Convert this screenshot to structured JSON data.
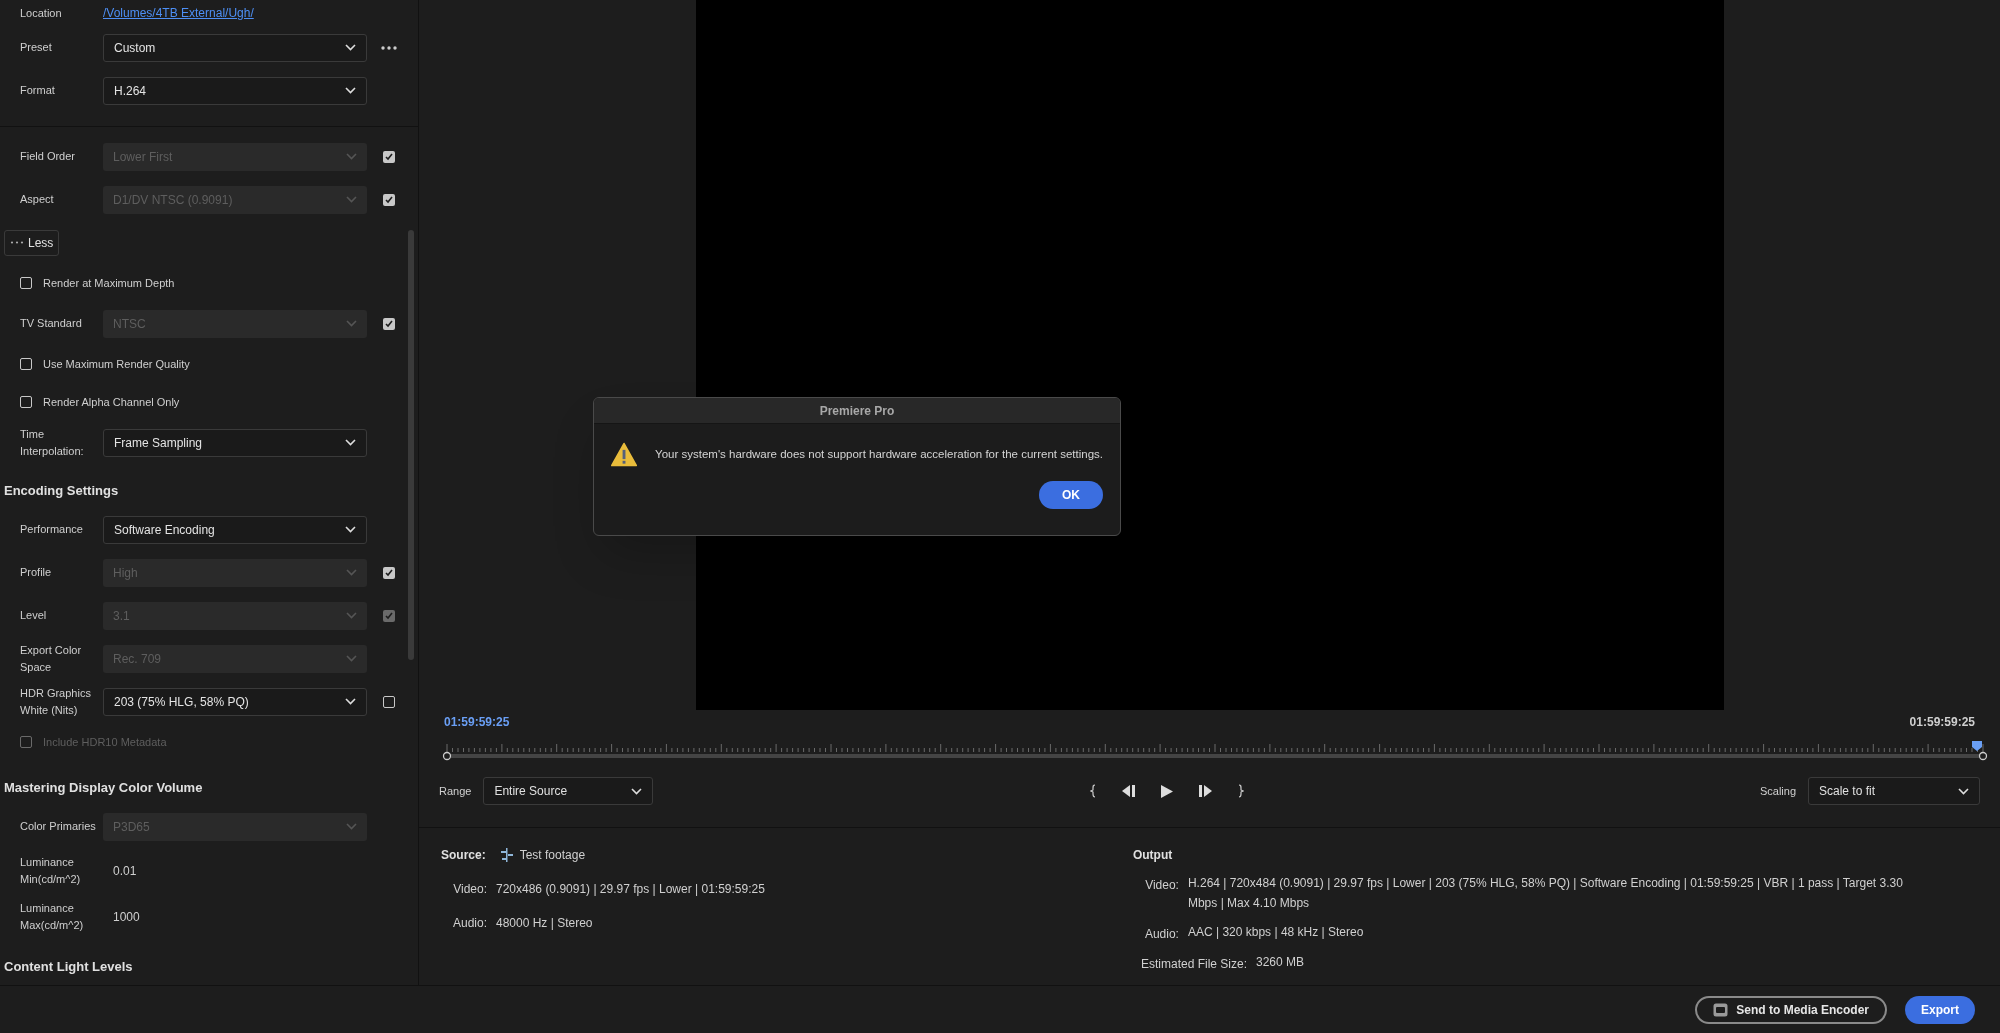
{
  "settings": [
    {
      "kind": "link",
      "label": "Location",
      "value": "/Volumes/4TB External/Ugh/"
    },
    {
      "kind": "dropdown",
      "label": "Preset",
      "value": "Custom",
      "disabled": false,
      "more": true
    },
    {
      "kind": "dropdown",
      "label": "Format",
      "value": "H.264",
      "disabled": false
    },
    {
      "kind": "divider"
    },
    {
      "kind": "dropdown",
      "label": "Field Order",
      "value": "Lower First",
      "disabled": true,
      "checked": true
    },
    {
      "kind": "dropdown",
      "label": "Aspect",
      "value": "D1/DV NTSC (0.9091)",
      "disabled": true,
      "checked": true
    },
    {
      "kind": "toggle",
      "label": "Less"
    },
    {
      "kind": "checkbox",
      "label": "Render at Maximum Depth",
      "checked": false,
      "disabled": false
    },
    {
      "kind": "dropdown",
      "label": "TV Standard",
      "value": "NTSC",
      "disabled": true,
      "checked": true
    },
    {
      "kind": "checkbox",
      "label": "Use Maximum Render Quality",
      "checked": false,
      "disabled": false
    },
    {
      "kind": "checkbox",
      "label": "Render Alpha Channel Only",
      "checked": false,
      "disabled": false
    },
    {
      "kind": "dropdown",
      "label": "Time Interpolation:",
      "value": "Frame Sampling",
      "disabled": false
    },
    {
      "kind": "heading",
      "label": "Encoding Settings"
    },
    {
      "kind": "dropdown",
      "label": "Performance",
      "value": "Software Encoding",
      "disabled": false
    },
    {
      "kind": "dropdown",
      "label": "Profile",
      "value": "High",
      "disabled": true,
      "checked": true
    },
    {
      "kind": "dropdown",
      "label": "Level",
      "value": "3.1",
      "disabled": true,
      "checked": true,
      "checkbox_disabled": true
    },
    {
      "kind": "dropdown",
      "label": "Export Color Space",
      "value": "Rec. 709",
      "disabled": true
    },
    {
      "kind": "dropdown",
      "label": "HDR Graphics White (Nits)",
      "value": "203 (75% HLG, 58% PQ)",
      "disabled": false,
      "checked": false
    },
    {
      "kind": "checkbox",
      "label": "Include HDR10 Metadata",
      "checked": false,
      "disabled": true
    },
    {
      "kind": "heading",
      "label": "Mastering Display Color Volume"
    },
    {
      "kind": "dropdown",
      "label": "Color Primaries",
      "value": "P3D65",
      "disabled": true
    },
    {
      "kind": "value",
      "label": "Luminance Min(cd/m^2)",
      "value": "0.01"
    },
    {
      "kind": "value",
      "label": "Luminance Max(cd/m^2)",
      "value": "1000"
    },
    {
      "kind": "heading",
      "label": "Content Light Levels"
    }
  ],
  "viewer": {
    "start_time": "01:59:59:25",
    "end_time": "01:59:59:25",
    "playhead": {
      "level": 1
    },
    "range": {
      "label": "Range",
      "value": "Entire Source"
    },
    "scaling": {
      "label": "Scaling",
      "value": "Scale to fit"
    }
  },
  "source": {
    "label": "Source:",
    "clip": "Test footage",
    "rows": [
      {
        "label": "Video:",
        "value": "720x486 (0.9091) | 29.97 fps | Lower | 01:59:59:25"
      },
      {
        "label": "Audio:",
        "value": "48000 Hz | Stereo"
      }
    ]
  },
  "output": {
    "title": "Output",
    "rows": [
      {
        "label": "Video:",
        "value": "H.264 | 720x484 (0.9091) | 29.97 fps | Lower | 203 (75% HLG, 58% PQ) | Software Encoding | 01:59:59:25 | VBR | 1 pass | Target 3.30 Mbps | Max 4.10 Mbps"
      },
      {
        "label": "Audio:",
        "value": "AAC | 320 kbps | 48 kHz | Stereo"
      },
      {
        "label": "Estimated File Size:",
        "value": "3260 MB"
      }
    ]
  },
  "footer": {
    "send_button": "Send to Media Encoder",
    "export_button": "Export"
  },
  "dialog": {
    "title": "Premiere Pro",
    "message": "Your system's hardware does not support hardware acceleration for the current settings.",
    "button": "OK"
  }
}
